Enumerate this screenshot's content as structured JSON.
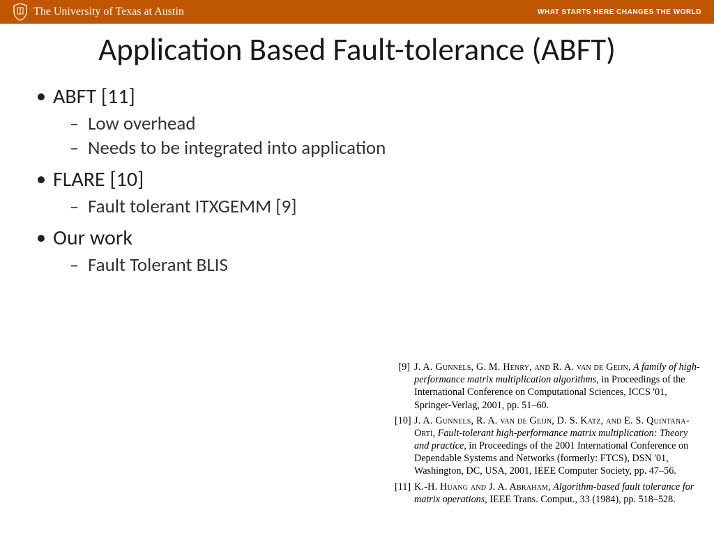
{
  "header": {
    "university": "The University of Texas at Austin",
    "tagline": "WHAT STARTS HERE CHANGES THE WORLD"
  },
  "title": "Application Based Fault-tolerance (ABFT)",
  "bullets": [
    {
      "text": "ABFT [11]",
      "children": [
        "Low overhead",
        "Needs to be integrated into application"
      ]
    },
    {
      "text": "FLARE [10]",
      "children": [
        "Fault tolerant ITXGEMM [9]"
      ]
    },
    {
      "text": "Our work",
      "children": [
        "Fault Tolerant BLIS"
      ]
    }
  ],
  "references": [
    {
      "num": "[9]",
      "authors": "J. A. Gunnels, G. M. Henry, and R. A. van de Geijn",
      "title": "A family of high-performance matrix multiplication algorithms",
      "rest": ", in Proceedings of the International Conference on Computational Sciences, ICCS '01, Springer-Verlag, 2001, pp. 51–60."
    },
    {
      "num": "[10]",
      "authors": "J. A. Gunnels, R. A. van de Geijn, D. S. Katz, and E. S. Quintana-Ortí",
      "title": "Fault-tolerant high-performance matrix multiplication: Theory and practice",
      "rest": ", in Proceedings of the 2001 International Conference on Dependable Systems and Networks (formerly: FTCS), DSN '01, Washington, DC, USA, 2001, IEEE Computer Society, pp. 47–56."
    },
    {
      "num": "[11]",
      "authors": "K.-H. Huang and J. A. Abraham",
      "title": "Algorithm-based fault tolerance for matrix operations",
      "rest": ", IEEE Trans. Comput., 33 (1984), pp. 518–528."
    }
  ]
}
